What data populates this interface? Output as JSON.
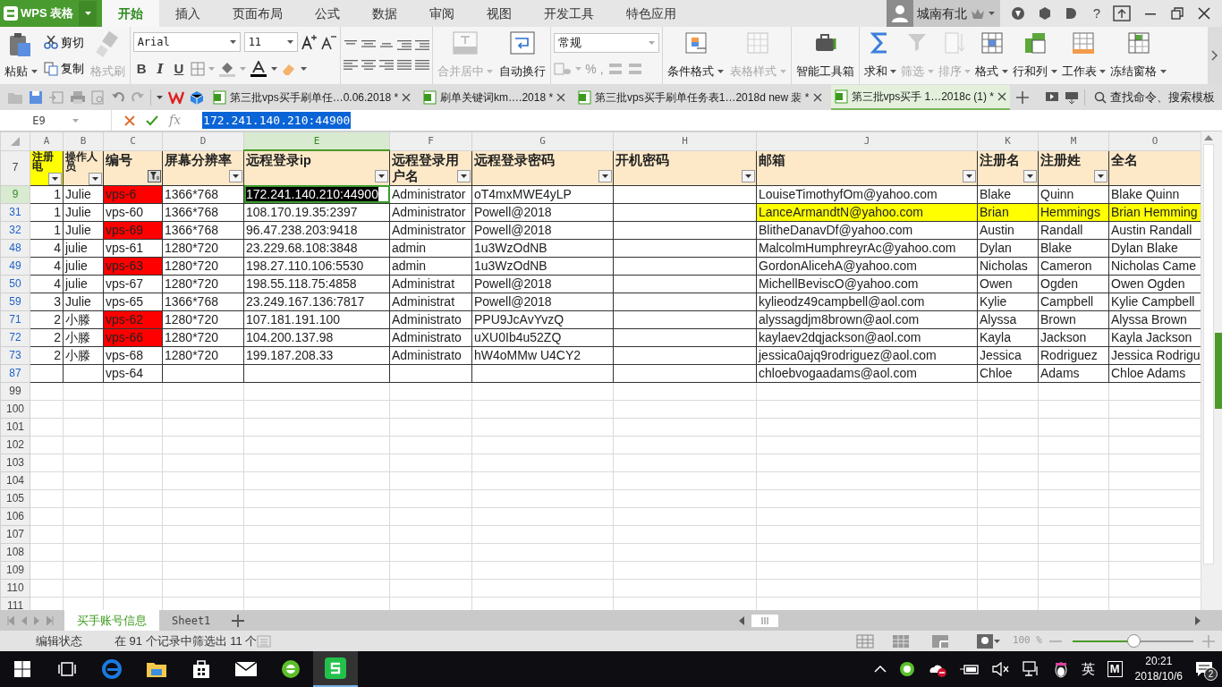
{
  "app": {
    "logo": "WPS 表格"
  },
  "menu_tabs": [
    {
      "label": "开始",
      "selected": true
    },
    {
      "label": "插入",
      "selected": false
    },
    {
      "label": "页面布局",
      "selected": false
    },
    {
      "label": "公式",
      "selected": false
    },
    {
      "label": "数据",
      "selected": false
    },
    {
      "label": "审阅",
      "selected": false
    },
    {
      "label": "视图",
      "selected": false
    },
    {
      "label": "开发工具",
      "selected": false
    },
    {
      "label": "特色应用",
      "selected": false
    }
  ],
  "user": {
    "name": "城南有北",
    "help": "?"
  },
  "ribbon": {
    "clipboard": [
      {
        "label": "粘贴",
        "menu": true,
        "disabled": false
      },
      {
        "label": "剪切",
        "menu": false,
        "disabled": false
      },
      {
        "label": "复制",
        "menu": false,
        "disabled": false
      },
      {
        "label": "格式刷",
        "menu": false,
        "disabled": true
      }
    ],
    "font": {
      "name": "Arial",
      "size": "11",
      "styles": [
        "B",
        "I",
        "U"
      ]
    },
    "merge": [
      {
        "label": "合并居中",
        "menu": true,
        "disabled": true
      },
      {
        "label": "自动换行",
        "menu": false,
        "disabled": false
      }
    ],
    "number": {
      "format": "常规",
      "symbols": [
        "%",
        ","
      ]
    },
    "tools": [
      {
        "label": "条件格式",
        "menu": true,
        "disabled": false
      },
      {
        "label": "表格样式",
        "menu": true,
        "disabled": true
      },
      {
        "label": "智能工具箱",
        "menu": false,
        "disabled": false
      },
      {
        "label": "求和",
        "menu": true,
        "disabled": false
      },
      {
        "label": "筛选",
        "menu": true,
        "disabled": true
      },
      {
        "label": "排序",
        "menu": true,
        "disabled": true
      },
      {
        "label": "格式",
        "menu": true,
        "disabled": false
      },
      {
        "label": "行和列",
        "menu": true,
        "disabled": false
      },
      {
        "label": "工作表",
        "menu": true,
        "disabled": false
      },
      {
        "label": "冻结窗格",
        "menu": true,
        "disabled": false
      }
    ]
  },
  "doc_tabs": [
    {
      "title": "第三批vps买手刷单任…0.06.2018 *",
      "selected": false
    },
    {
      "title": "刷单关键词km….2018 *",
      "selected": false
    },
    {
      "title": "第三批vps买手刷单任务表1…2018d new 裴 *",
      "selected": false
    },
    {
      "title": "第三批vps买手 1…2018c (1) *",
      "selected": true
    }
  ],
  "search": {
    "label": "查找命令、搜索模板"
  },
  "formula_bar": {
    "cell_ref": "E9",
    "fx": "fx",
    "value": "172.241.140.210:44900"
  },
  "columns": [
    {
      "letter": "A",
      "selected": false
    },
    {
      "letter": "B",
      "selected": false
    },
    {
      "letter": "C",
      "selected": false
    },
    {
      "letter": "D",
      "selected": false
    },
    {
      "letter": "E",
      "selected": true
    },
    {
      "letter": "F",
      "selected": false
    },
    {
      "letter": "G",
      "selected": false
    },
    {
      "letter": "H",
      "selected": false
    },
    {
      "letter": "J",
      "selected": false
    },
    {
      "letter": "K",
      "selected": false
    },
    {
      "letter": "M",
      "selected": false
    },
    {
      "letter": "O",
      "selected": false
    }
  ],
  "header_row": {
    "number": "7",
    "cells": [
      {
        "text": "注册电",
        "color": "#ffff00",
        "filter_button": true,
        "filtered": false
      },
      {
        "text": "操作人员",
        "filter_button": true,
        "filtered": false
      },
      {
        "text": "编号",
        "filter_button": true,
        "filtered": true
      },
      {
        "text": "屏幕分辨率",
        "filter_button": true,
        "filtered": false
      },
      {
        "text": "远程登录ip",
        "filter_button": true,
        "filtered": false
      },
      {
        "text": "远程登录用户名",
        "filter_button": true,
        "filtered": false
      },
      {
        "text": "远程登录密码",
        "filter_button": true,
        "filtered": false
      },
      {
        "text": "开机密码",
        "filter_button": true,
        "filtered": false
      },
      {
        "text": "邮箱",
        "filter_button": true,
        "filtered": false
      },
      {
        "text": "注册名",
        "filter_button": true,
        "filtered": false
      },
      {
        "text": "注册姓",
        "filter_button": true,
        "filtered": false
      },
      {
        "text": "全名",
        "filter_button": false
      }
    ]
  },
  "rows": [
    {
      "number": "9",
      "selected": true,
      "cells": [
        "1",
        "Julie",
        {
          "text": "vps-6",
          "color": "#ff0000"
        },
        "1366*768",
        "172.241.140.210:44900",
        "Administrator",
        "oT4mxMWE4yLP",
        null,
        "LouiseTimothyfOm@yahoo.com",
        "Blake",
        "Quinn",
        "Blake Quinn"
      ]
    },
    {
      "number": "31",
      "selected": false,
      "cells": [
        "1",
        "Julie",
        "vps-60",
        "1366*768",
        "108.170.19.35:2397",
        "Administrator",
        "Powell@2018",
        null,
        {
          "text": "LanceArmandtN@yahoo.com",
          "color": "#ffff00"
        },
        {
          "text": "Brian",
          "color": "#ffff00"
        },
        {
          "text": "Hemmings",
          "color": "#ffff00"
        },
        {
          "text": "Brian Hemming",
          "color": "#ffff00"
        }
      ]
    },
    {
      "number": "32",
      "selected": false,
      "cells": [
        "1",
        "Julie",
        {
          "text": "vps-69",
          "color": "#ff0000"
        },
        "1366*768",
        "96.47.238.203:9418",
        "Administrator",
        "Powell@2018",
        null,
        "BlitheDanavDf@yahoo.com",
        "Austin",
        "Randall",
        "Austin Randall"
      ]
    },
    {
      "number": "48",
      "selected": false,
      "cells": [
        "4",
        "julie",
        "vps-61",
        "1280*720",
        "23.229.68.108:3848",
        "admin",
        "1u3WzOdNB",
        null,
        "MalcolmHumphreyrAc@yahoo.com",
        "Dylan",
        "Blake",
        "Dylan Blake"
      ]
    },
    {
      "number": "49",
      "selected": false,
      "cells": [
        "4",
        "julie",
        {
          "text": "vps-63",
          "color": "#ff0000"
        },
        "1280*720",
        "198.27.110.106:5530",
        "admin",
        "1u3WzOdNB",
        null,
        "GordonAlicehA@yahoo.com",
        "Nicholas",
        "Cameron",
        "Nicholas Came"
      ]
    },
    {
      "number": "50",
      "selected": false,
      "cells": [
        "4",
        "julie",
        "vps-67",
        "1280*720",
        "198.55.118.75:4858",
        "Administrat",
        "Powell@2018",
        null,
        "MichellBeviscO@yahoo.com",
        "Owen",
        "Ogden",
        "Owen Ogden"
      ]
    },
    {
      "number": "59",
      "selected": false,
      "cells": [
        "3",
        "Julie",
        "vps-65",
        "1366*768",
        "23.249.167.136:7817",
        "Administrat",
        "Powell@2018",
        null,
        "kylieodz49campbell@aol.com",
        "Kylie",
        "Campbell",
        "Kylie Campbell"
      ]
    },
    {
      "number": "71",
      "selected": false,
      "cells": [
        "2",
        "小滕",
        {
          "text": "vps-62",
          "color": "#ff0000"
        },
        "1280*720",
        "107.181.191.100",
        "Administrato",
        "PPU9JcAvYvzQ",
        null,
        "alyssagdjm8brown@aol.com",
        "Alyssa",
        "Brown",
        "Alyssa Brown"
      ]
    },
    {
      "number": "72",
      "selected": false,
      "cells": [
        "2",
        "小滕",
        {
          "text": "vps-66",
          "color": "#ff0000"
        },
        "1280*720",
        "104.200.137.98",
        "Administrato",
        "uXU0Ib4u52ZQ",
        null,
        "kaylaev2dqjackson@aol.com",
        "Kayla",
        "Jackson",
        "Kayla Jackson"
      ]
    },
    {
      "number": "73",
      "selected": false,
      "cells": [
        "2",
        "小滕",
        "vps-68",
        "1280*720",
        "199.187.208.33",
        "Administrato",
        "hW4oMMw U4CY2",
        null,
        "jessica0ajq9rodriguez@aol.com",
        "Jessica",
        "Rodriguez",
        "Jessica Rodrigu"
      ]
    },
    {
      "number": "87",
      "selected": false,
      "cells": [
        null,
        null,
        "vps-64",
        null,
        null,
        null,
        null,
        null,
        "chloebvogaadams@aol.com",
        "Chloe",
        "Adams",
        "Chloe Adams"
      ]
    }
  ],
  "empty_rows": [
    "99",
    "100",
    "101",
    "102",
    "103",
    "104",
    "105",
    "106",
    "107",
    "108",
    "109",
    "110",
    "111"
  ],
  "sheet_tabs": [
    {
      "label": "买手账号信息",
      "selected": true
    },
    {
      "label": "Sheet1",
      "selected": false
    }
  ],
  "status_bar": {
    "mode": "编辑状态",
    "filter_info": "在 91 个记录中筛选出 11 个",
    "zoom": {
      "reading": "100 %",
      "level": 0.5
    }
  },
  "taskbar": {
    "ime": "英",
    "m_label": "M",
    "time": "20:21",
    "date": "2018/10/6",
    "notifications": "2"
  }
}
